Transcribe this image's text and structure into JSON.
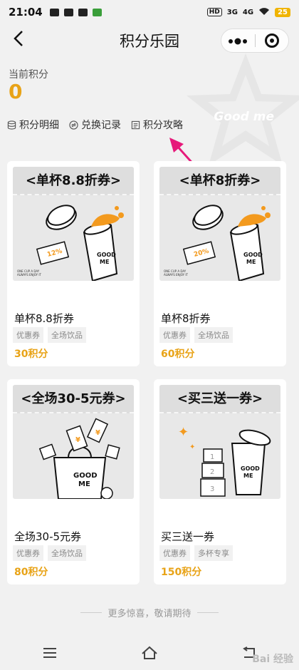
{
  "status_bar": {
    "time": "21:04",
    "network_3g": "3G",
    "network_4g": "4G",
    "hd": "HD",
    "battery": "25"
  },
  "header": {
    "title": "积分乐园",
    "back_icon": "chevron-left-icon",
    "more_icon": "more-dots-icon",
    "close_icon": "target-icon"
  },
  "background": {
    "brand": "Good me"
  },
  "points": {
    "label": "当前积分",
    "value": "0"
  },
  "nav_links": [
    {
      "label": "积分明细",
      "icon": "database-icon"
    },
    {
      "label": "兑换记录",
      "icon": "exchange-icon"
    },
    {
      "label": "积分攻略",
      "icon": "document-icon"
    }
  ],
  "cards": [
    {
      "banner": "<单杯8.8折券>",
      "name": "单杯8.8折券",
      "tags": [
        "优惠券",
        "全场饮品"
      ],
      "price": "30积分",
      "ticket_text": "12%",
      "caption": [
        "ONE CUP A DAY",
        "ALWAYS ENJOY IT"
      ],
      "cup_text": [
        "GOOD",
        "ME"
      ]
    },
    {
      "banner": "<单杯8折券>",
      "name": "单杯8折券",
      "tags": [
        "优惠券",
        "全场饮品"
      ],
      "price": "60积分",
      "ticket_text": "20%",
      "caption": [
        "ONE CUP A DAY",
        "ALWAYS ENJOY IT"
      ],
      "cup_text": [
        "GOOD",
        "ME"
      ]
    },
    {
      "banner": "<全场30-5元券>",
      "name": "全场30-5元券",
      "tags": [
        "优惠券",
        "全场饮品"
      ],
      "price": "80积分",
      "bag_text": [
        "GOOD",
        "ME"
      ]
    },
    {
      "banner": "<买三送一券>",
      "name": "买三送一券",
      "tags": [
        "优惠券",
        "多杯专享"
      ],
      "price": "150积分",
      "cup_text": [
        "GOOD",
        "ME"
      ],
      "stack_numbers": [
        "1",
        "2",
        "3"
      ]
    }
  ],
  "footer": {
    "more": "更多惊喜，敬请期待"
  },
  "colors": {
    "accent": "#e8a317",
    "arrow": "#e6197a",
    "splash": "#f39a1e"
  },
  "watermark": "Bai 经验"
}
